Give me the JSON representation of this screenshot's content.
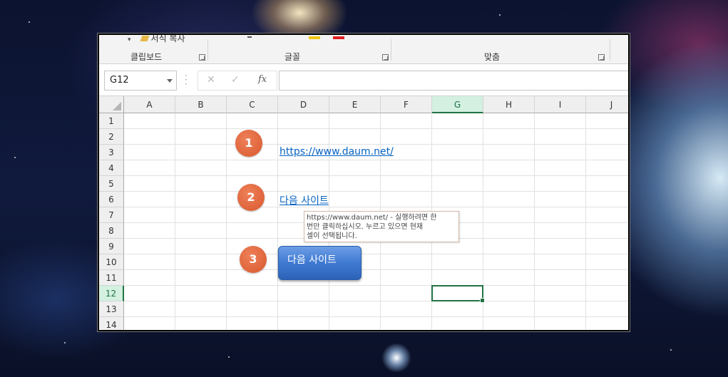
{
  "ribbon": {
    "clipboard_item": "서식 복사",
    "groups": [
      "클립보드",
      "글꼴",
      "맞춤"
    ]
  },
  "formula_bar": {
    "name_box": "G12",
    "cancel_icon": "✕",
    "enter_icon": "✓",
    "fx_label": "fx",
    "formula": ""
  },
  "sheet": {
    "columns": [
      "A",
      "B",
      "C",
      "D",
      "E",
      "F",
      "G",
      "H",
      "I",
      "J"
    ],
    "rows": [
      "1",
      "2",
      "3",
      "4",
      "5",
      "6",
      "7",
      "8",
      "9",
      "10",
      "11",
      "12",
      "13",
      "14"
    ],
    "selected_column": "G",
    "selected_row": "12"
  },
  "cells": {
    "d3_link": "https://www.daum.net/",
    "d6_link": "다음 사이트"
  },
  "badges": [
    "1",
    "2",
    "3"
  ],
  "tooltip": {
    "line1": "https://www.daum.net/ - 실행하려면 한",
    "line2": "번만 클릭하십시오. 누르고 있으면 현재",
    "line3": "셀이 선택됩니다."
  },
  "shape_button": {
    "label": "다음 사이트"
  },
  "colors": {
    "accent_green": "#217346",
    "link_blue": "#0563c1",
    "badge_orange": "#e2683c",
    "button_blue": "#3f7ad2"
  }
}
